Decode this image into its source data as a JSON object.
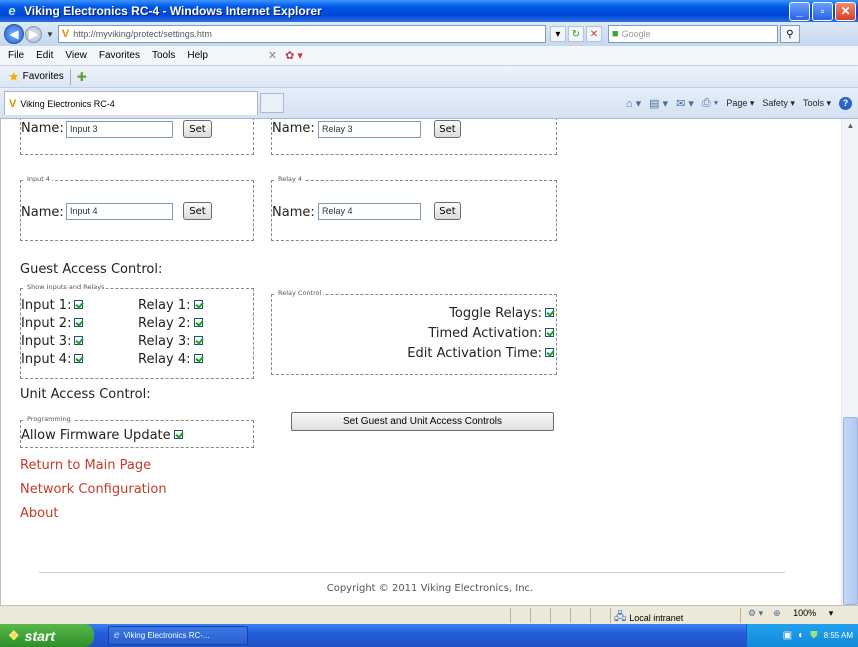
{
  "window": {
    "title": "Viking Electronics RC-4 - Windows Internet Explorer",
    "minimize_glyph": "_",
    "maximize_glyph": "▫",
    "close_glyph": "✕"
  },
  "address_bar": {
    "url": "http://myviking/protect/settings.htm",
    "search_placeholder": "Google"
  },
  "menu": {
    "items": [
      "File",
      "Edit",
      "View",
      "Favorites",
      "Tools",
      "Help"
    ]
  },
  "favorites_bar": {
    "label": "Favorites"
  },
  "tabs": [
    {
      "label": "Viking Electronics RC-4"
    }
  ],
  "command_bar": {
    "page": "Page ▾",
    "safety": "Safety ▾",
    "tools": "Tools ▾"
  },
  "inputs": [
    {
      "label": "Name:",
      "value": "Input 3",
      "button": "Set"
    },
    {
      "legend": "Input 4",
      "label": "Name:",
      "value": "Input 4",
      "button": "Set"
    }
  ],
  "relays": [
    {
      "label": "Name:",
      "value": "Relay 3",
      "button": "Set"
    },
    {
      "legend": "Relay 4",
      "label": "Name:",
      "value": "Relay 4",
      "button": "Set"
    }
  ],
  "guest_access": {
    "heading": "Guest Access Control:",
    "show_legend": "Show Inputs and Relays",
    "input_items": [
      {
        "label": "Input 1:",
        "checked": true
      },
      {
        "label": "Input 2:",
        "checked": true
      },
      {
        "label": "Input 3:",
        "checked": true
      },
      {
        "label": "Input 4:",
        "checked": true
      }
    ],
    "relay_items": [
      {
        "label": "Relay 1:",
        "checked": true
      },
      {
        "label": "Relay 2:",
        "checked": true
      },
      {
        "label": "Relay 3:",
        "checked": true
      },
      {
        "label": "Relay 4:",
        "checked": true
      }
    ],
    "relay_control_legend": "Relay Control",
    "relay_control_items": [
      {
        "label": "Toggle Relays:",
        "checked": true
      },
      {
        "label": "Timed Activation:",
        "checked": true
      },
      {
        "label": "Edit Activation Time:",
        "checked": true
      }
    ]
  },
  "unit_access": {
    "heading": "Unit Access Control:",
    "programming_legend": "Programming",
    "allow_firmware": "Allow Firmware Update",
    "allow_firmware_checked": true,
    "submit_button": "Set Guest and Unit Access Controls"
  },
  "links": [
    "Return to Main Page",
    "Network Configuration",
    "About"
  ],
  "footer": {
    "copyright": "Copyright © 2011 Viking Electronics, Inc."
  },
  "status_bar": {
    "zone": "Local intranet",
    "zoom": "100%"
  },
  "taskbar": {
    "start": "start",
    "task": "Viking Electronics RC-...",
    "clock": "8:55 AM"
  },
  "colors": {
    "link": "#c73a2b",
    "checkmark": "#21a121",
    "titlebar": "#0058e6"
  }
}
